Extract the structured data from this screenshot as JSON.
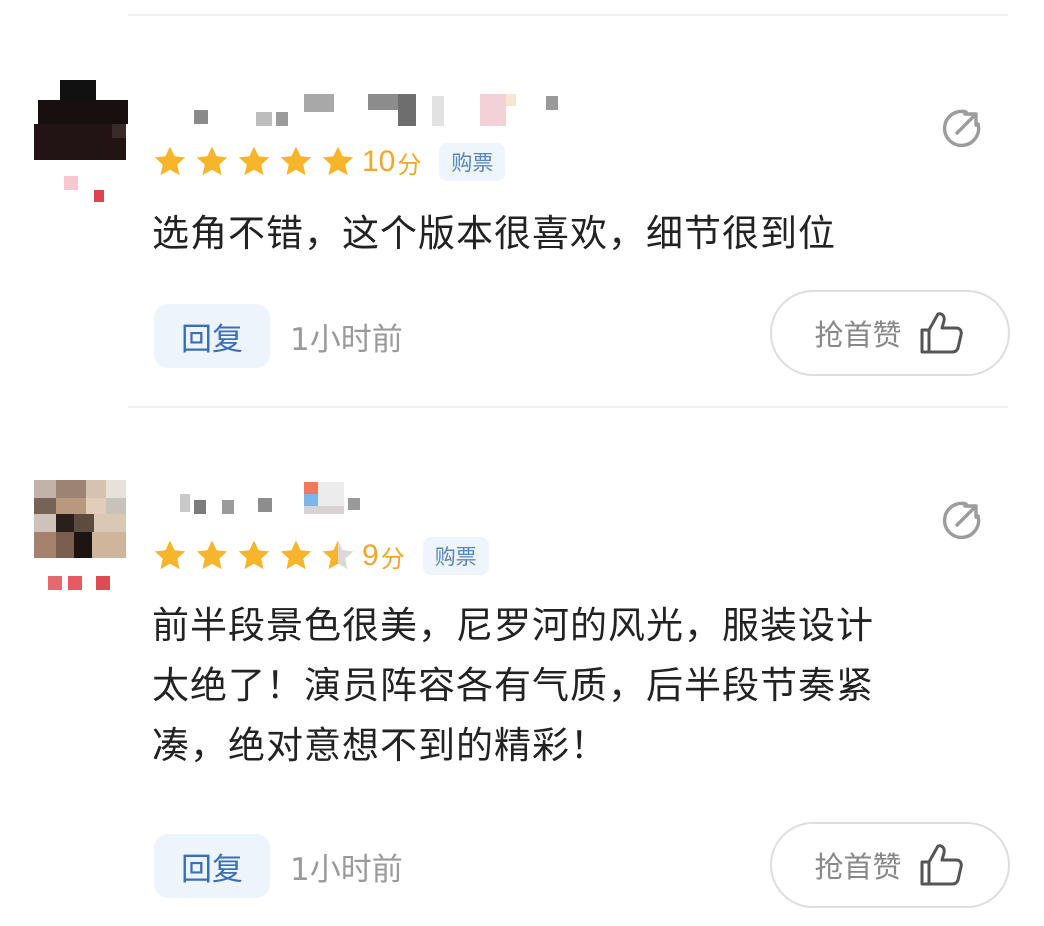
{
  "reviews": [
    {
      "score": "10",
      "score_unit": "分",
      "stars": 5,
      "tag": "购票",
      "content_lines": [
        "选角不错，这个版本很喜欢，细节很到位"
      ],
      "reply_label": "回复",
      "time": "1小时前",
      "like_label": "抢首赞"
    },
    {
      "score": "9",
      "score_unit": "分",
      "stars": 4.5,
      "tag": "购票",
      "content_lines": [
        "前半段景色很美，尼罗河的风光，服装设计",
        "太绝了！演员阵容各有气质，后半段节奏紧",
        "凑，绝对意想不到的精彩！"
      ],
      "reply_label": "回复",
      "time": "1小时前",
      "like_label": "抢首赞"
    }
  ],
  "colors": {
    "star": "#f7b52c",
    "star_empty": "#d9d9d9",
    "score": "#f5a623",
    "tag_bg": "#eef5fd",
    "tag_text": "#5886bf",
    "reply_text": "#3a6fb6"
  },
  "icons": {
    "share": "share-icon",
    "like": "thumb-up-icon",
    "star": "star-icon"
  }
}
